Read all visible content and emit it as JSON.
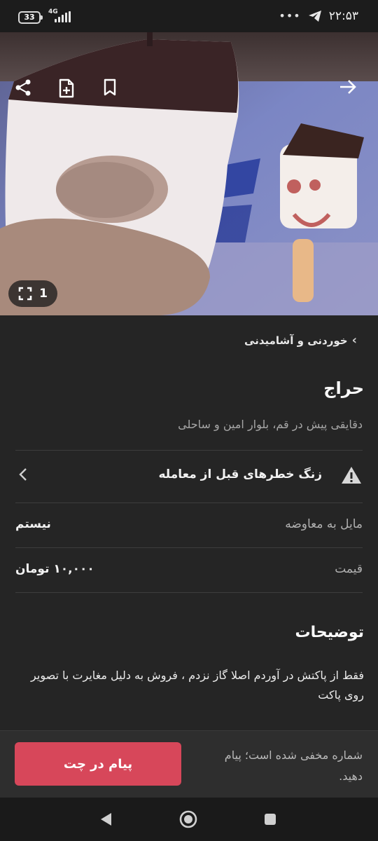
{
  "status_bar": {
    "battery": "33",
    "network": "4G",
    "time": "۲۲:۵۳",
    "dots": "•••"
  },
  "hero": {
    "photo_count": "1",
    "icons": [
      "share-icon",
      "add-note-icon",
      "bookmark-icon",
      "arrow-forward-icon",
      "fullscreen-icon"
    ]
  },
  "breadcrumb": {
    "category": "خوردنی و آشامیدنی"
  },
  "listing": {
    "title": "حراج",
    "subtitle": "دقایقی پیش در قم، بلوار امین و ساحلی",
    "alert": "زنگ خطرهای قبل از معامله",
    "fields": [
      {
        "label": "مایل به معاوضه",
        "value": "نیستم"
      },
      {
        "label": "قیمت",
        "value": "۱۰,۰۰۰ تومان"
      }
    ],
    "description_title": "توضیحات",
    "description": "فقط از پاکتش در آوردم اصلا گاز نزدم ، فروش به دلیل مغایرت با تصویر روی پاکت"
  },
  "action_bar": {
    "chat_button": "پیام در چت",
    "hidden_note": "شماره مخفی شده است؛ پیام دهید."
  },
  "colors": {
    "background": "#252525",
    "accent": "#d7475a",
    "text_primary": "#f2f2f2",
    "text_secondary": "#b0b0b0"
  }
}
